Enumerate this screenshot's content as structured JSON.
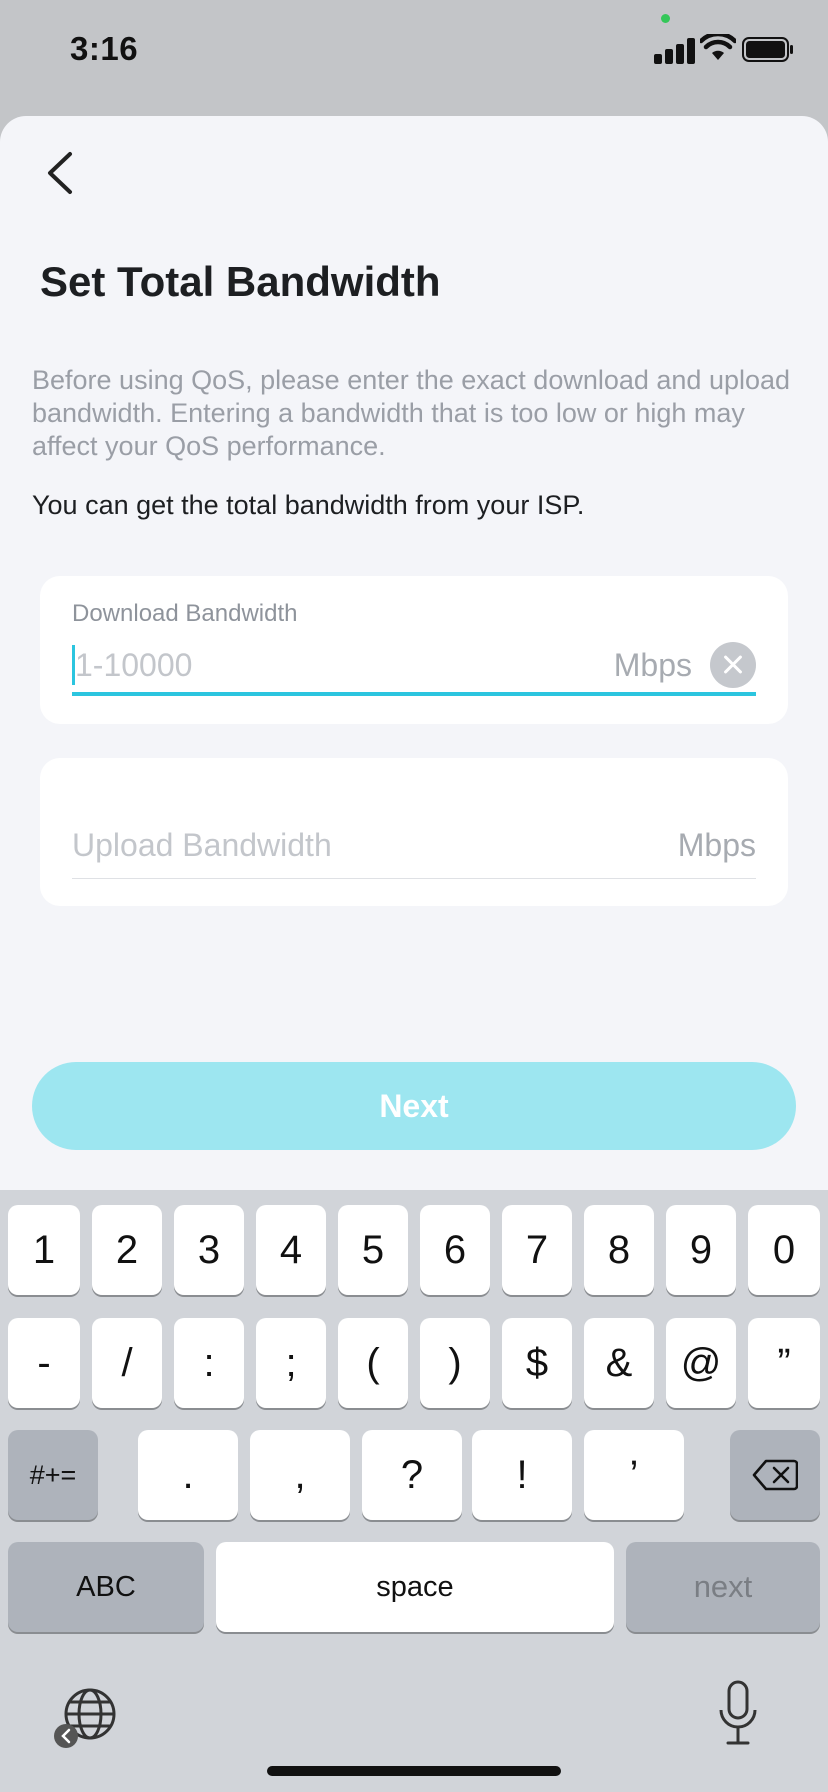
{
  "status_bar": {
    "time": "3:16"
  },
  "page": {
    "title": "Set Total Bandwidth",
    "description": "Before using QoS, please enter the exact download and upload bandwidth. Entering a bandwidth that is too low or high may affect your QoS performance.",
    "note": "You can get the total bandwidth from your ISP."
  },
  "download": {
    "label": "Download Bandwidth",
    "placeholder": "1-10000",
    "value": "",
    "unit": "Mbps"
  },
  "upload": {
    "placeholder": "Upload Bandwidth",
    "value": "",
    "unit": "Mbps"
  },
  "next_button": {
    "label": "Next"
  },
  "colors": {
    "accent": "#2bc5df",
    "button_disabled": "#9de6f0",
    "sheet_bg": "#f4f5f9"
  },
  "keyboard": {
    "row1": [
      "1",
      "2",
      "3",
      "4",
      "5",
      "6",
      "7",
      "8",
      "9",
      "0"
    ],
    "row2": [
      "-",
      "/",
      ":",
      ";",
      "(",
      ")",
      "$",
      "&",
      "@",
      "”"
    ],
    "row3": {
      "mode": "#+=",
      "keys": [
        ".",
        ",",
        "?",
        "!",
        "’"
      ]
    },
    "row4": {
      "abc": "ABC",
      "space": "space",
      "return": "next"
    },
    "icons": [
      "delete-icon",
      "globe-icon",
      "microphone-icon"
    ]
  }
}
